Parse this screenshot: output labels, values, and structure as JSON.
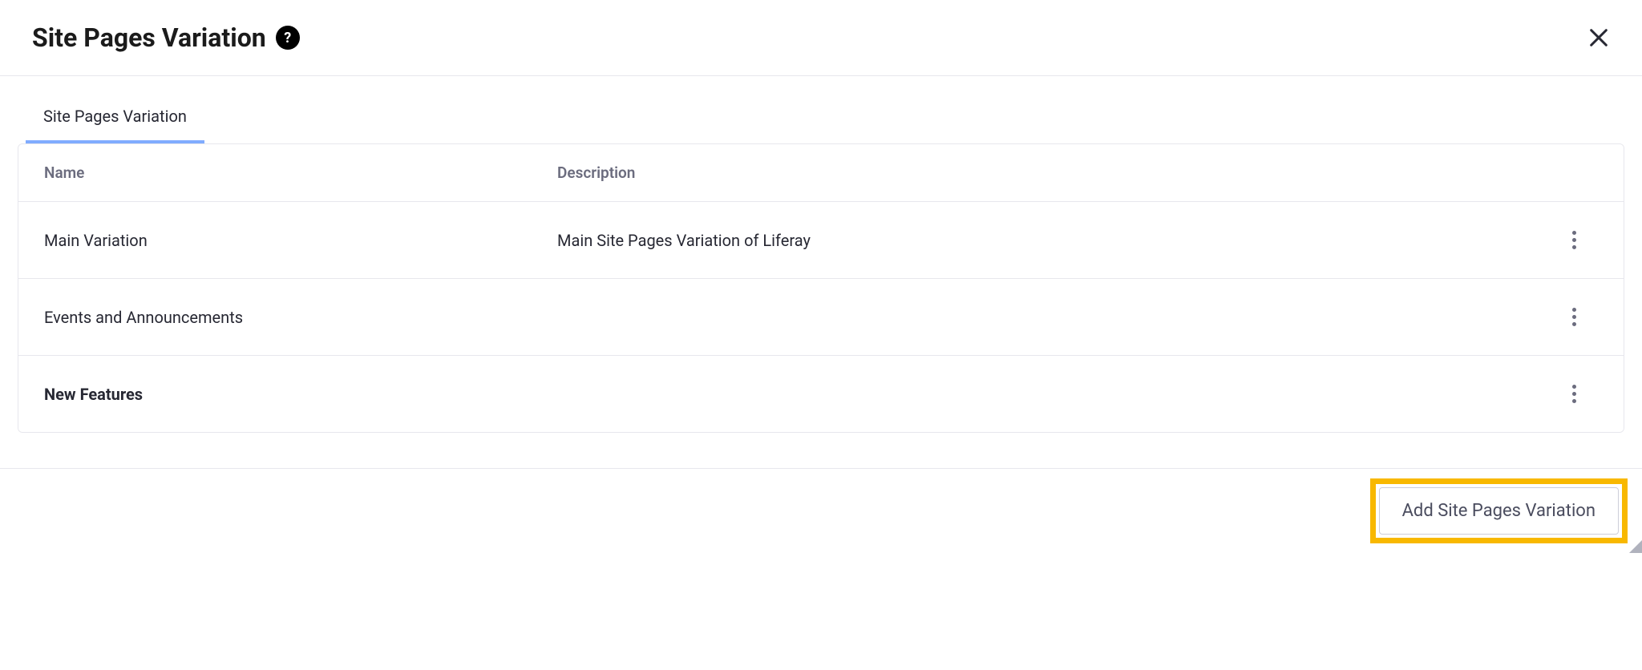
{
  "header": {
    "title": "Site Pages Variation"
  },
  "tabs": [
    {
      "label": "Site Pages Variation",
      "active": true
    }
  ],
  "table": {
    "columns": {
      "name": "Name",
      "description": "Description"
    },
    "rows": [
      {
        "name": "Main Variation",
        "description": "Main Site Pages Variation of Liferay",
        "bold": false
      },
      {
        "name": "Events and Announcements",
        "description": "",
        "bold": false
      },
      {
        "name": "New Features",
        "description": "",
        "bold": true
      }
    ]
  },
  "footer": {
    "add_button_label": "Add Site Pages Variation"
  }
}
